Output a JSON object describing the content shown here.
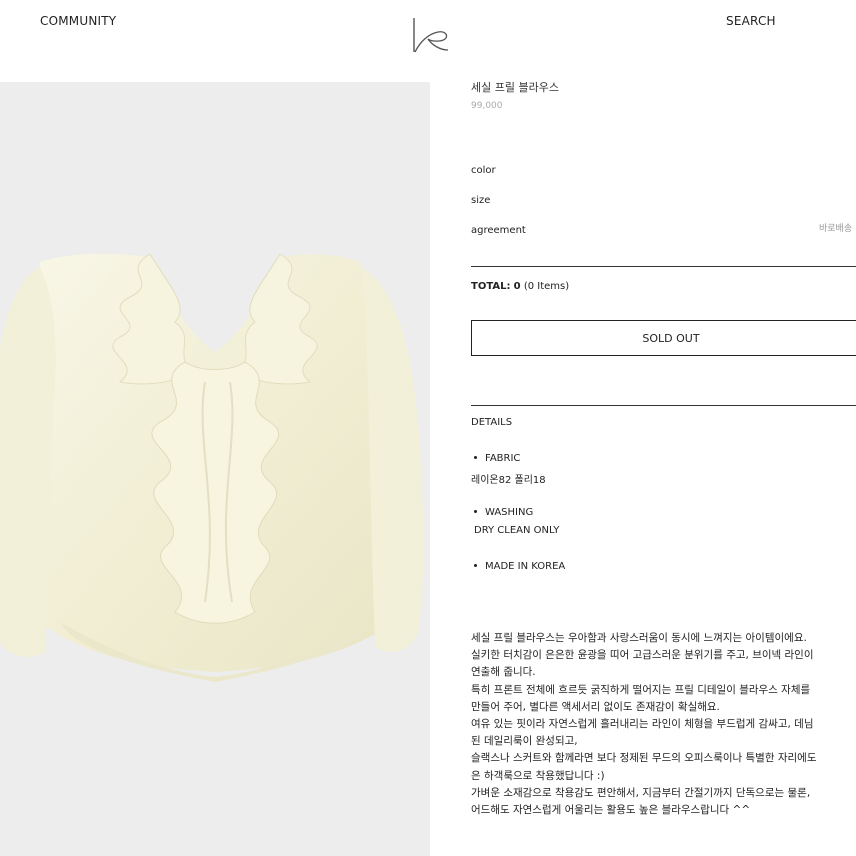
{
  "header": {
    "nav_left": "COMMUNITY",
    "nav_right": "SEARCH",
    "logo_icon": "ke-monogram-logo"
  },
  "product": {
    "title": "세실 프릴 블라우스",
    "price": "99,000",
    "image_icon": "ruffle-blouse-photo",
    "image_bg_color": "#ededed",
    "garment_color": "#f5f2dd"
  },
  "options": {
    "color_label": "color",
    "size_label": "size",
    "agreement_label": "agreement",
    "delivery_note": "바로배송"
  },
  "total": {
    "label": "TOTAL:",
    "amount": "0",
    "items": "(0 Items)"
  },
  "buy_button": {
    "label": "SOLD OUT"
  },
  "details": {
    "heading": "DETAILS",
    "fabric_label": "FABRIC",
    "fabric_value": "레이온82 폴리18",
    "washing_label": "WASHING",
    "washing_value": "DRY CLEAN ONLY",
    "origin_label": "MADE IN KOREA"
  },
  "description": [
    "세실 프릴 블라우스는 우아함과 사랑스러움이 동시에 느껴지는 아이템이에요.",
    "실키한 터치감이 은은한 윤광을 띠어 고급스러운 분위기를 주고, 브이넥 라인이",
    "연출해 줍니다.",
    "특히 프론트 전체에 흐르듯 굵직하게 떨어지는 프릴 디테일이 블라우스 자체를",
    "만들어 주어, 별다른 액세서리 없이도 존재감이 확실해요.",
    "여유 있는 핏이라 자연스럽게 흘러내리는 라인이 체형을 부드럽게 감싸고, 데님",
    "된 데일리룩이 완성되고,",
    "슬랙스나 스커트와 함께라면 보다 정제된 무드의 오피스룩이나 특별한 자리에도",
    "은 하객룩으로 착용했답니다 :)",
    "가벼운 소재감으로 착용감도 편안해서, 지금부터 간절기까지 단독으로는 물론,",
    "어드해도 자연스럽게 어울리는 활용도 높은 블라우스랍니다 ^^"
  ]
}
